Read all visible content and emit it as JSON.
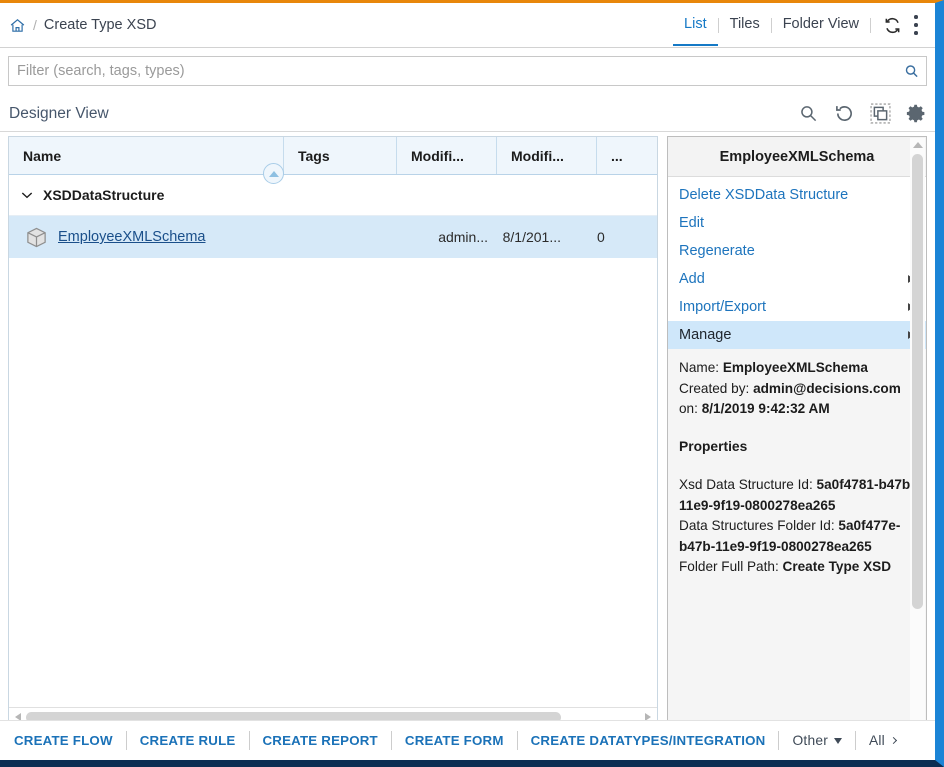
{
  "theme": {
    "top_accent": "#e8870a",
    "right_accent": "#1b84d6",
    "bottom_accent": "#0b2e52",
    "link_blue": "#1d74bd",
    "action_blue": "#1b72b8",
    "row_selected": "#d6e9f8",
    "menu_highlight": "#cfe7fa",
    "header_fill": "#eff6fc"
  },
  "breadcrumb": {
    "home_icon": "home-icon",
    "separator": "/",
    "current": "Create Type XSD"
  },
  "view_tabs": [
    {
      "label": "List",
      "active": true
    },
    {
      "label": "Tiles",
      "active": false
    },
    {
      "label": "Folder View",
      "active": false
    }
  ],
  "titlebar_icons": [
    {
      "name": "refresh-icon"
    },
    {
      "name": "kebab-menu-icon"
    }
  ],
  "filter": {
    "placeholder": "Filter (search, tags, types)",
    "value": "",
    "search_icon": "search-icon"
  },
  "designer_view": {
    "title": "Designer View",
    "tools": [
      {
        "name": "search-icon"
      },
      {
        "name": "refresh-history-icon"
      },
      {
        "name": "copy-icon"
      },
      {
        "name": "gear-icon"
      }
    ]
  },
  "grid": {
    "columns": [
      "Name",
      "Tags",
      "Modifi...",
      "Modifi...",
      "..."
    ],
    "sort_indicator": "sort-ascending-icon",
    "group": {
      "label": "XSDDataStructure",
      "expanded": true,
      "chevron": "chevron-down-icon"
    },
    "rows": [
      {
        "icon": "cube-icon",
        "name": "EmployeeXMLSchema",
        "tags": "",
        "modified_by": "admin...",
        "modified_date": "8/1/201...",
        "extra": "0",
        "selected": true
      }
    ],
    "hscroll": {
      "left_arrow": "scroll-left-arrow",
      "right_arrow": "scroll-right-arrow"
    }
  },
  "side_panel": {
    "header": "EmployeeXMLSchema",
    "menu": [
      {
        "label": "Delete XSDData Structure",
        "submenu": false,
        "highlighted": false
      },
      {
        "label": "Edit",
        "submenu": false,
        "highlighted": false
      },
      {
        "label": "Regenerate",
        "submenu": false,
        "highlighted": false
      },
      {
        "label": "Add",
        "submenu": true,
        "highlighted": false
      },
      {
        "label": "Import/Export",
        "submenu": true,
        "highlighted": false
      },
      {
        "label": "Manage",
        "submenu": true,
        "highlighted": true
      }
    ],
    "info": {
      "name_label": "Name:",
      "name_value": "EmployeeXMLSchema",
      "created_by_label": "Created by:",
      "created_by_value": "admin@decisions.com",
      "on_label": "on:",
      "on_value": "8/1/2019 9:42:32 AM",
      "properties_title": "Properties",
      "xsd_id_label": "Xsd Data Structure Id:",
      "xsd_id_value": "5a0f4781-b47b-11e9-9f19-0800278ea265",
      "folder_id_label": "Data Structures Folder Id:",
      "folder_id_value": "5a0f477e-b47b-11e9-9f19-0800278ea265",
      "folder_path_label": "Folder Full Path:",
      "folder_path_value": "Create Type XSD"
    },
    "vscroll": {
      "up_arrow": "scroll-up-arrow"
    }
  },
  "action_bar": {
    "primary": [
      "CREATE FLOW",
      "CREATE RULE",
      "CREATE REPORT",
      "CREATE FORM",
      "CREATE DATATYPES/INTEGRATION"
    ],
    "other_label": "Other",
    "all_label": "All"
  }
}
